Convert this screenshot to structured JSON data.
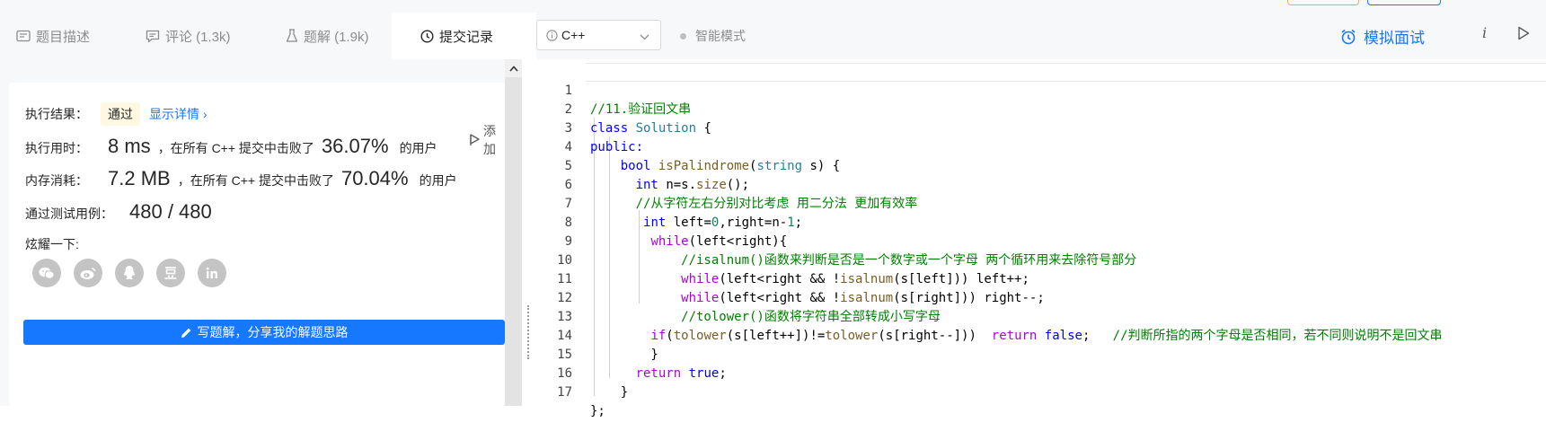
{
  "tabs": [
    {
      "label": "题目描述",
      "icon": "description-icon"
    },
    {
      "label": "评论 (1.3k)",
      "icon": "comment-icon"
    },
    {
      "label": "题解 (1.9k)",
      "icon": "flask-icon"
    },
    {
      "label": "提交记录",
      "icon": "clock-icon"
    }
  ],
  "result": {
    "label": "执行结果：",
    "status": "通过",
    "detail_link": "显示详情 ›",
    "add_label": "添加"
  },
  "runtime": {
    "label": "执行用时：",
    "value": "8 ms",
    "middle": "，在所有 C++ 提交中击败了",
    "percent": "36.07%",
    "suffix": "的用户"
  },
  "memory": {
    "label": "内存消耗：",
    "value": "7.2 MB",
    "middle": "，在所有 C++ 提交中击败了",
    "percent": "70.04%",
    "suffix": "的用户"
  },
  "tests": {
    "label": "通过测试用例：",
    "value": "480 / 480"
  },
  "share": {
    "label": "炫耀一下:",
    "icons": [
      "wechat-icon",
      "weibo-icon",
      "qq-icon",
      "douban-icon",
      "linkedin-icon"
    ]
  },
  "write_button": "写题解，分享我的解题思路",
  "editor": {
    "language": "C++",
    "mode": "智能模式",
    "mock_interview": "模拟面试",
    "info": "i"
  },
  "code_lines": [
    "//11.验证回文串",
    "class Solution {",
    "public:",
    "    bool isPalindrome(string s) {",
    "      int n=s.size();",
    "      //从字符左右分别对比考虑 用二分法 更加有效率",
    "       int left=0,right=n-1;",
    "        while(left<right){",
    "            //isalnum()函数来判断是否是一个数字或一个字母 两个循环用来去除符号部分",
    "            while(left<right && !isalnum(s[left])) left++;",
    "            while(left<right && !isalnum(s[right])) right--;",
    "            //tolower()函数将字符串全部转成小写字母",
    "        if(tolower(s[left++])!=tolower(s[right--]))  return false;   //判断所指的两个字母是否相同，若不同则说明不是回文串",
    "        }",
    "      return true;",
    "    }",
    "};"
  ],
  "line_numbers": [
    "1",
    "2",
    "3",
    "4",
    "5",
    "6",
    "7",
    "8",
    "9",
    "10",
    "11",
    "12",
    "13",
    "14",
    "15",
    "16",
    "17"
  ]
}
